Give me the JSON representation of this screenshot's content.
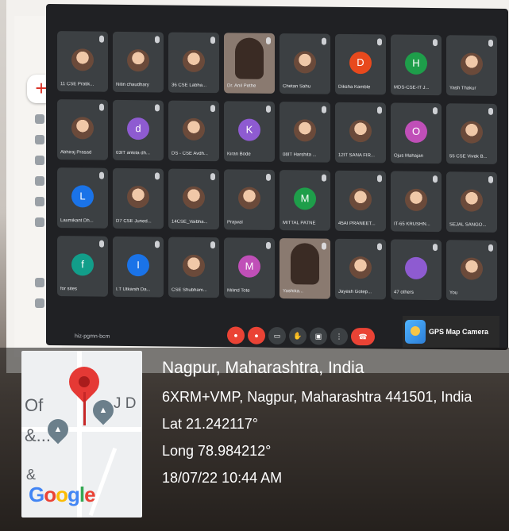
{
  "meet": {
    "participants": [
      {
        "name": "11 CSE Pratik...",
        "avatar": "",
        "color": "#7a5230",
        "photo": true
      },
      {
        "name": "Nitin chaudhary",
        "avatar": "",
        "color": "#8a6a50",
        "photo": true
      },
      {
        "name": "36 CSE Labha...",
        "avatar": "",
        "color": "#c0392b",
        "photo": true
      },
      {
        "name": "Dr. Anil Pethe",
        "avatar": "",
        "color": "",
        "video": true
      },
      {
        "name": "Chetan Sahu",
        "avatar": "",
        "color": "#2b3a55",
        "photo": true
      },
      {
        "name": "Diksha Kamble",
        "avatar": "D",
        "color": "#e8491d"
      },
      {
        "name": "MDS-CSE-IT J...",
        "avatar": "H",
        "color": "#1e9e4a"
      },
      {
        "name": "Yash Thakur",
        "avatar": "",
        "color": "#8a6a50",
        "photo": true
      },
      {
        "name": "Abhiraj Prasad",
        "avatar": "",
        "color": "#7a5230",
        "photo": true
      },
      {
        "name": "03IT ankita dh...",
        "avatar": "d",
        "color": "#8e5bd1"
      },
      {
        "name": "DS - CSE Avdh...",
        "avatar": "",
        "color": "#4a3a30",
        "photo": true
      },
      {
        "name": "Kiran Bode",
        "avatar": "K",
        "color": "#8e5bd1"
      },
      {
        "name": "08IT Harshita ...",
        "avatar": "",
        "color": "#5a4a40",
        "photo": true
      },
      {
        "name": "12IT SANA FIR...",
        "avatar": "",
        "color": "#e07040",
        "photo": true
      },
      {
        "name": "Ojus Mahajan",
        "avatar": "O",
        "color": "#c04fb8"
      },
      {
        "name": "55 CSE Vivek B...",
        "avatar": "",
        "color": "#3a6a7a",
        "photo": true
      },
      {
        "name": "Laxmikant Dh...",
        "avatar": "L",
        "color": "#1a73e8"
      },
      {
        "name": "D7 CSE Juned...",
        "avatar": "",
        "color": "#6a5a50",
        "photo": true
      },
      {
        "name": "14CSE_Vaibha...",
        "avatar": "",
        "color": "#b08030",
        "photo": true
      },
      {
        "name": "Prajwal",
        "avatar": "",
        "color": "#2a2a2a",
        "photo": true
      },
      {
        "name": "MITTAL PATNE",
        "avatar": "M",
        "color": "#1e9e4a"
      },
      {
        "name": "45AI PRANEET...",
        "avatar": "",
        "color": "#5a4a40",
        "photo": true
      },
      {
        "name": "IT-65 KRUSHN...",
        "avatar": "",
        "color": "#2a2a2a",
        "photo": true
      },
      {
        "name": "SEJAL SANGO...",
        "avatar": "",
        "color": "#c08070",
        "photo": true
      },
      {
        "name": "for sites",
        "avatar": "f",
        "color": "#129e8a"
      },
      {
        "name": "I.T Utkarsh Da...",
        "avatar": "I",
        "color": "#1a73e8"
      },
      {
        "name": "CSE Shubham...",
        "avatar": "",
        "color": "#d0c8b8",
        "photo": true
      },
      {
        "name": "Milind Tote",
        "avatar": "M",
        "color": "#c04fb8"
      },
      {
        "name": "Yashika...",
        "avatar": "",
        "color": "",
        "video": true
      },
      {
        "name": "Jayesh Gotep...",
        "avatar": "",
        "color": "#6a5a50",
        "photo": true
      },
      {
        "name": "47 others",
        "avatar": "",
        "color": "#8e5bd1",
        "photo": false
      },
      {
        "name": "You",
        "avatar": "",
        "color": "#8a6a50",
        "photo": true
      }
    ],
    "meeting_code": "hiz-pgmn-bcm",
    "controls": [
      "mic",
      "cam",
      "cc",
      "hand",
      "present",
      "more",
      "end"
    ]
  },
  "gps_badge": {
    "label": "GPS Map Camera"
  },
  "map": {
    "labels": [
      "Of",
      "J D",
      "&...",
      "&"
    ],
    "google": "Google"
  },
  "location": {
    "city": "Nagpur, Maharashtra, India",
    "address": "6XRM+VMP, Nagpur, Maharashtra 441501, India",
    "lat": "Lat 21.242117°",
    "long": "Long 78.984212°",
    "datetime": "18/07/22 10:44 AM"
  },
  "colors": {
    "meet_bg": "#202124",
    "tile_bg": "#3c4043",
    "end_call": "#ea4335",
    "pin": "#e53935"
  }
}
